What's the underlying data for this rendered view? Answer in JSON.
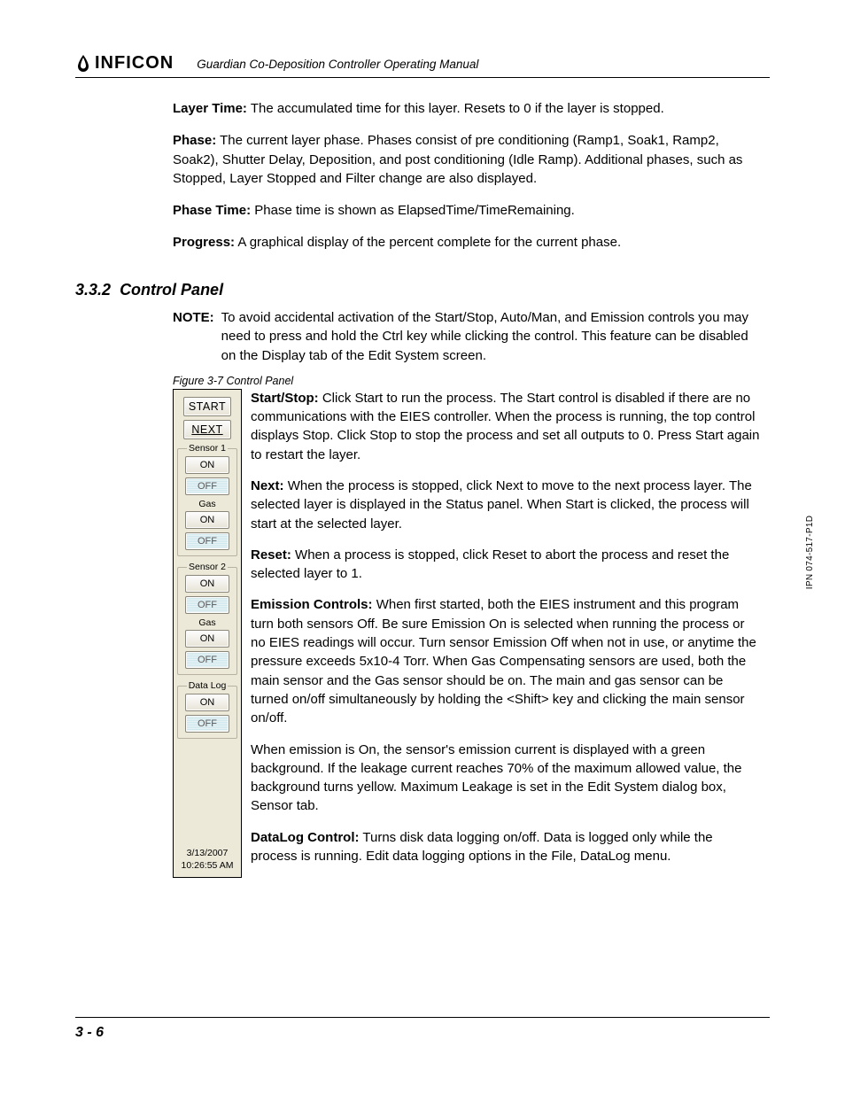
{
  "header": {
    "brand": "INFICON",
    "doc_title": "Guardian Co-Deposition Controller Operating Manual"
  },
  "defs": {
    "layer_time": {
      "label": "Layer Time:",
      "text": "The accumulated time for this layer. Resets to 0 if the layer is stopped."
    },
    "phase": {
      "label": "Phase:",
      "text": "The current layer phase. Phases consist of pre conditioning (Ramp1, Soak1, Ramp2, Soak2), Shutter Delay, Deposition, and post conditioning (Idle Ramp). Additional phases, such as Stopped, Layer Stopped and Filter change are also displayed."
    },
    "phase_time": {
      "label": "Phase Time:",
      "text": "Phase time is shown as ElapsedTime/TimeRemaining."
    },
    "progress": {
      "label": "Progress:",
      "text": "A graphical display of the percent complete for the current phase."
    }
  },
  "section": {
    "num": "3.3.2",
    "title": "Control Panel"
  },
  "note": {
    "label": "NOTE:",
    "text": "To avoid accidental activation of the Start/Stop, Auto/Man, and Emission controls you may need to press and hold the Ctrl key while clicking the control. This feature can be disabled on the Display tab of the Edit System screen."
  },
  "figure": {
    "caption": "Figure 3-7  Control Panel"
  },
  "panel": {
    "start": "START",
    "next": "NEXT",
    "sensor1": "Sensor 1",
    "sensor2": "Sensor 2",
    "gas": "Gas",
    "on": "ON",
    "off": "OFF",
    "datalog": "Data Log",
    "date": "3/13/2007",
    "time": "10:26:55 AM"
  },
  "desc": {
    "startstop": {
      "label": "Start/Stop:",
      "text": "Click Start to run the process. The Start control is disabled if there are no communications with the EIES controller. When the process is running, the top control displays Stop. Click Stop to stop the process and set all outputs to 0. Press Start again to restart the layer."
    },
    "next": {
      "label": "Next:",
      "text": "When the process is stopped, click Next to move to the next process layer. The selected layer is displayed in the Status panel. When Start is clicked, the process will start at the selected layer."
    },
    "reset": {
      "label": "Reset:",
      "text": "When a process is stopped, click Reset to abort the process and reset the selected layer to 1."
    },
    "emission": {
      "label": "Emission Controls:",
      "text": "When first started, both the EIES instrument and this program turn both sensors Off. Be sure Emission On is selected when running the process or no EIES readings will occur. Turn sensor Emission Off when not in use, or anytime the pressure exceeds 5x10-4 Torr. When Gas Compensating sensors are used, both the main sensor and the Gas sensor should be on. The main and gas sensor can be turned on/off simultaneously by holding the <Shift> key and clicking the main sensor on/off."
    },
    "emission2": "When emission is On, the sensor's emission current is displayed with a green background. If the leakage current reaches 70% of the maximum allowed value, the background turns yellow. Maximum Leakage is set in the Edit System dialog box, Sensor tab.",
    "datalog": {
      "label": "DataLog Control:",
      "text": "Turns disk data logging on/off. Data is logged only while the process is running. Edit data logging options in the File, DataLog menu."
    }
  },
  "footer": {
    "page": "3 - 6"
  },
  "side": {
    "ipn": "IPN 074-517-P1D"
  }
}
